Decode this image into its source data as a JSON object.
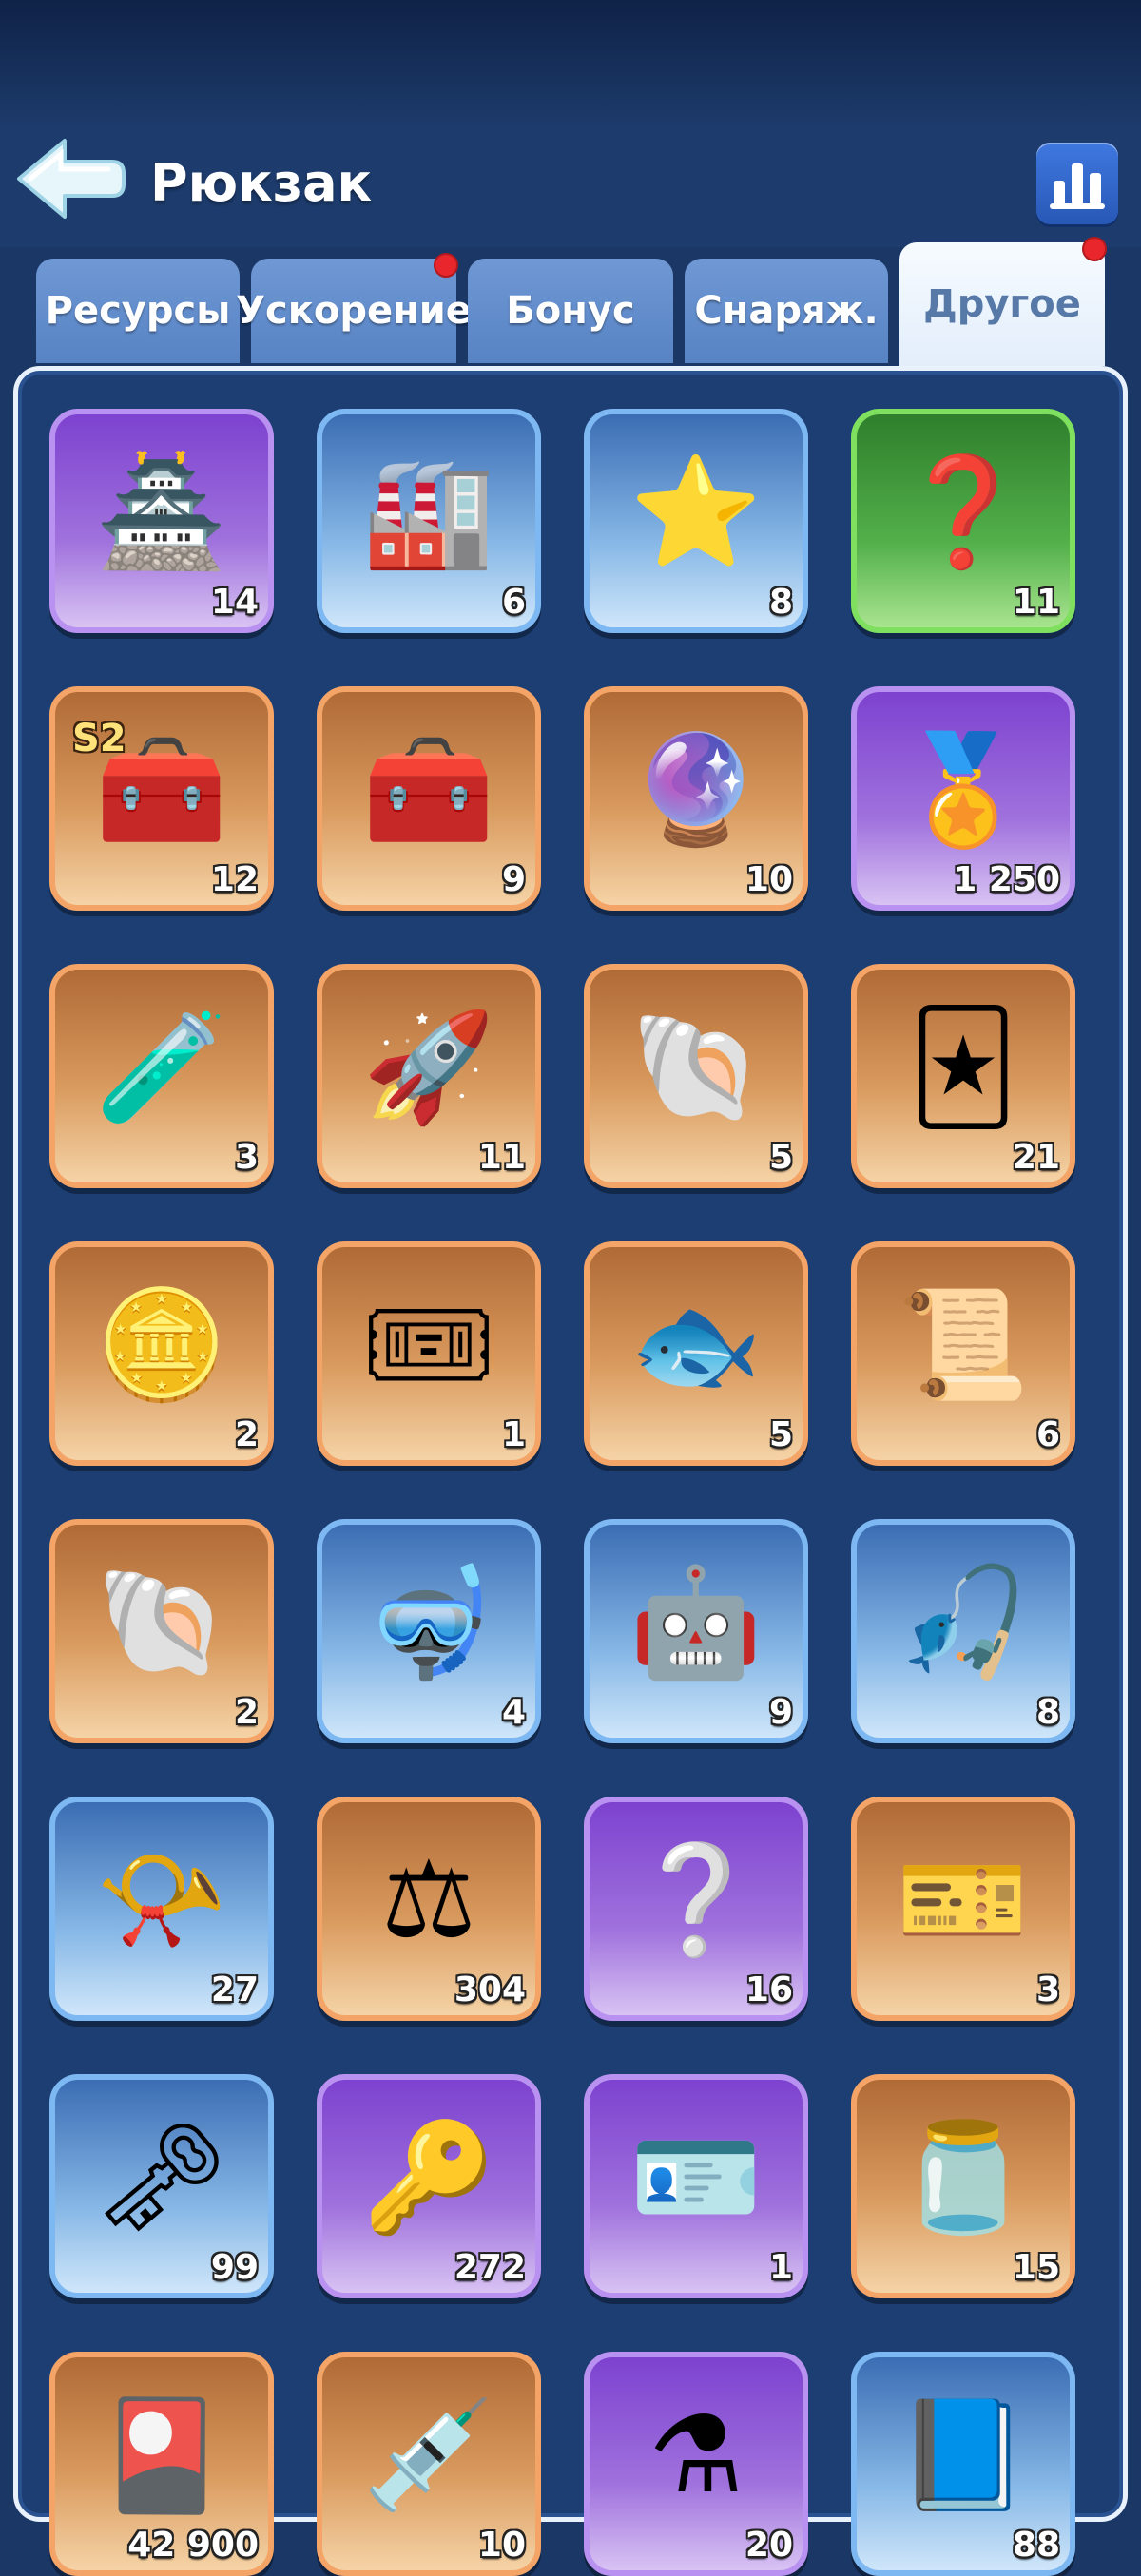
{
  "header": {
    "title": "Рюкзак"
  },
  "tabs": [
    {
      "label": "Ресурсы",
      "active": false,
      "notification": false
    },
    {
      "label": "Ускорение",
      "active": false,
      "notification": true
    },
    {
      "label": "Бонус",
      "active": false,
      "notification": false
    },
    {
      "label": "Снаряж.",
      "active": false,
      "notification": false
    },
    {
      "label": "Другое",
      "active": true,
      "notification": true
    }
  ],
  "items": [
    {
      "icon": "tower-building-icon",
      "rarity": "purple",
      "count": "14"
    },
    {
      "icon": "forge-building-icon",
      "rarity": "blue",
      "count": "6"
    },
    {
      "icon": "star-banner-icon",
      "rarity": "blue",
      "count": "8"
    },
    {
      "icon": "random-building-icon",
      "rarity": "green",
      "count": "11"
    },
    {
      "icon": "s2-treasure-chest-icon",
      "rarity": "orange",
      "count": "12",
      "badge": "S2"
    },
    {
      "icon": "treasure-chest-icon",
      "rarity": "orange",
      "count": "9"
    },
    {
      "icon": "purple-rune-stone-icon",
      "rarity": "orange",
      "count": "10"
    },
    {
      "icon": "mystery-gold-medal-icon",
      "rarity": "purple",
      "count": "1 250"
    },
    {
      "icon": "potion-crate-icon",
      "rarity": "orange",
      "count": "3"
    },
    {
      "icon": "rocket-pack-icon",
      "rarity": "orange",
      "count": "11"
    },
    {
      "icon": "shell-token-icon",
      "rarity": "orange",
      "count": "5"
    },
    {
      "icon": "purple-card-icon",
      "rarity": "orange",
      "count": "21"
    },
    {
      "icon": "gold-coin-icon",
      "rarity": "orange",
      "count": "2"
    },
    {
      "icon": "exchange-ticket-icon",
      "rarity": "orange",
      "count": "1"
    },
    {
      "icon": "fishing-ticket-icon",
      "rarity": "orange",
      "count": "5"
    },
    {
      "icon": "treasure-map-icon",
      "rarity": "orange",
      "count": "6"
    },
    {
      "icon": "seashell-icon",
      "rarity": "orange",
      "count": "2"
    },
    {
      "icon": "diving-helmet-icon",
      "rarity": "blue",
      "count": "4"
    },
    {
      "icon": "robot-drone-icon",
      "rarity": "blue",
      "count": "9"
    },
    {
      "icon": "fishing-reel-icon",
      "rarity": "blue",
      "count": "8"
    },
    {
      "icon": "horn-icon",
      "rarity": "blue",
      "count": "27"
    },
    {
      "icon": "justice-ticket-icon",
      "rarity": "orange",
      "count": "304"
    },
    {
      "icon": "mystery-card-icon",
      "rarity": "purple",
      "count": "16"
    },
    {
      "icon": "gold-ticket-icon",
      "rarity": "orange",
      "count": "3"
    },
    {
      "icon": "silver-key-icon",
      "rarity": "blue",
      "count": "99"
    },
    {
      "icon": "gold-key-icon",
      "rarity": "purple",
      "count": "272"
    },
    {
      "icon": "id-tag-icon",
      "rarity": "purple",
      "count": "1"
    },
    {
      "icon": "jam-jar-icon",
      "rarity": "orange",
      "count": "15"
    },
    {
      "icon": "pet-card-icon",
      "rarity": "orange",
      "count": "42 900"
    },
    {
      "icon": "syringe-icon",
      "rarity": "orange",
      "count": "10"
    },
    {
      "icon": "paw-potion-icon",
      "rarity": "purple",
      "count": "20"
    },
    {
      "icon": "paw-book-icon",
      "rarity": "blue",
      "count": "88"
    }
  ],
  "glyphs": {
    "tower-building-icon": "🏯",
    "forge-building-icon": "🏭",
    "star-banner-icon": "⭐",
    "random-building-icon": "❓",
    "s2-treasure-chest-icon": "🧰",
    "treasure-chest-icon": "🧰",
    "purple-rune-stone-icon": "🔮",
    "mystery-gold-medal-icon": "🏅",
    "potion-crate-icon": "🧪",
    "rocket-pack-icon": "🚀",
    "shell-token-icon": "🐚",
    "purple-card-icon": "🃏",
    "gold-coin-icon": "🪙",
    "exchange-ticket-icon": "🎟",
    "fishing-ticket-icon": "🐟",
    "treasure-map-icon": "📜",
    "seashell-icon": "🐚",
    "diving-helmet-icon": "🤿",
    "robot-drone-icon": "🤖",
    "fishing-reel-icon": "🎣",
    "horn-icon": "📯",
    "justice-ticket-icon": "⚖",
    "mystery-card-icon": "❔",
    "gold-ticket-icon": "🎫",
    "silver-key-icon": "🗝",
    "gold-key-icon": "🔑",
    "id-tag-icon": "🪪",
    "jam-jar-icon": "🫙",
    "pet-card-icon": "🎴",
    "syringe-icon": "💉",
    "paw-potion-icon": "⚗",
    "paw-book-icon": "📘"
  }
}
